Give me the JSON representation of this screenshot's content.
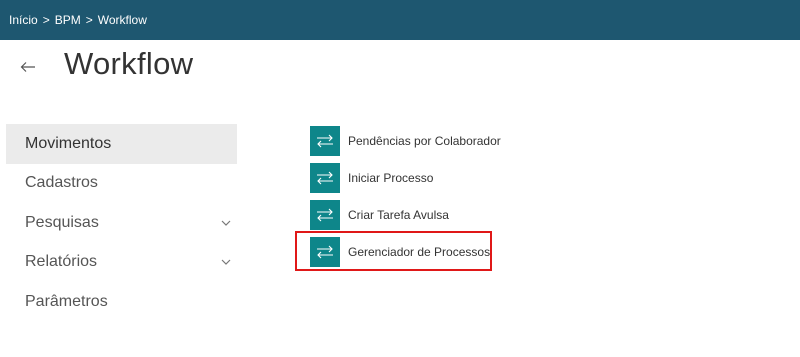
{
  "breadcrumb": {
    "items": [
      "Início",
      "BPM",
      "Workflow"
    ],
    "separator": ">"
  },
  "header": {
    "back_icon": "arrow-left-icon",
    "title": "Workflow"
  },
  "sidebar": {
    "items": [
      {
        "label": "Movimentos",
        "active": true,
        "expandable": false
      },
      {
        "label": "Cadastros",
        "active": false,
        "expandable": false
      },
      {
        "label": "Pesquisas",
        "active": false,
        "expandable": true
      },
      {
        "label": "Relatórios",
        "active": false,
        "expandable": true
      },
      {
        "label": "Parâmetros",
        "active": false,
        "expandable": false
      }
    ]
  },
  "menu": {
    "icon": "swap-arrows-icon",
    "items": [
      {
        "label": "Pendências por Colaborador"
      },
      {
        "label": "Iniciar Processo"
      },
      {
        "label": "Criar Tarefa Avulsa"
      },
      {
        "label": "Gerenciador de Processos",
        "highlighted": true
      }
    ]
  },
  "colors": {
    "topbar": "#1e5770",
    "menu_icon_bg": "#0e868a",
    "active_item_bg": "#ebebeb",
    "highlight_border": "#e01818"
  }
}
